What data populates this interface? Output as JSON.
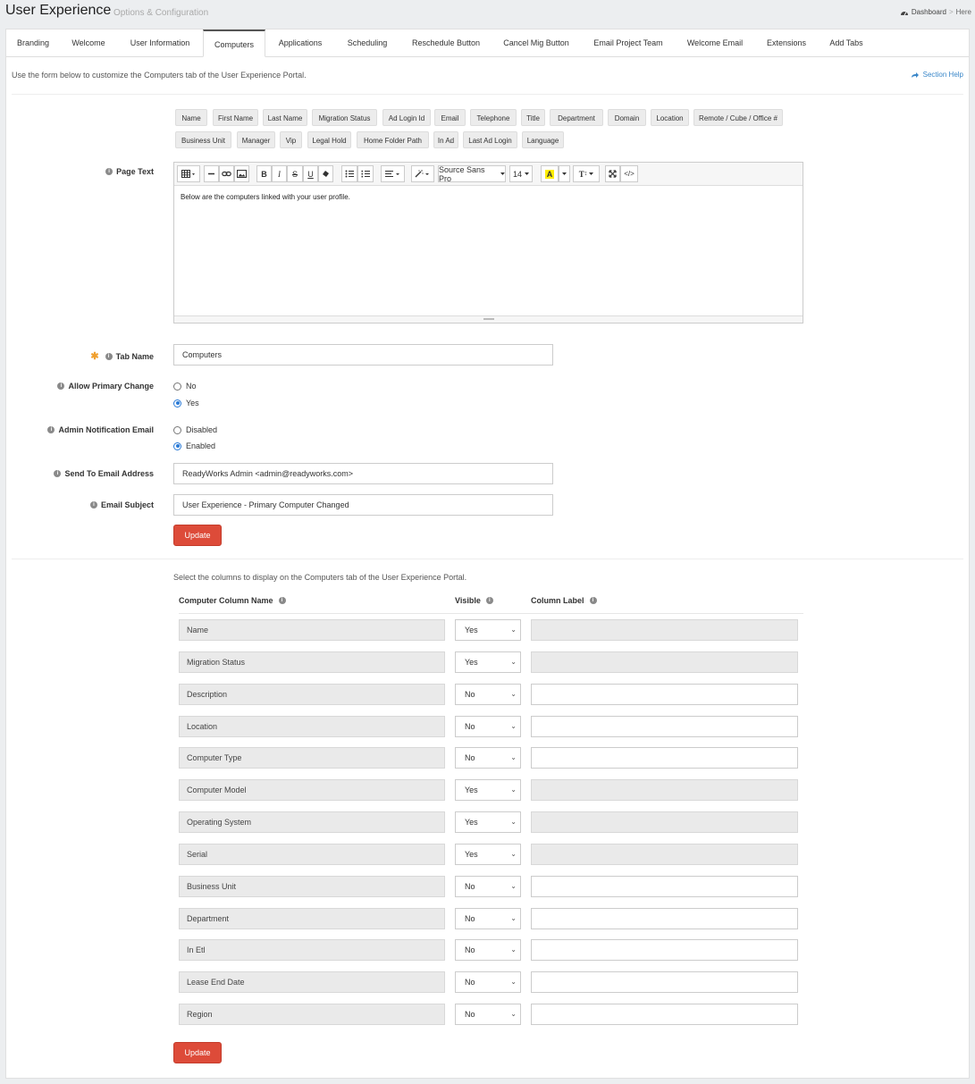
{
  "header": {
    "title": "User Experience",
    "subtitle": "Options & Configuration",
    "breadcrumb": [
      "Dashboard",
      "Here"
    ]
  },
  "tabs": [
    "Branding",
    "Welcome",
    "User Information",
    "Computers",
    "Applications",
    "Scheduling",
    "Reschedule Button",
    "Cancel Mig Button",
    "Email Project Team",
    "Welcome Email",
    "Extensions",
    "Add Tabs"
  ],
  "active_tab": "Computers",
  "intro": "Use the form below to customize the Computers tab of the User Experience Portal.",
  "section_help": "Section Help",
  "tokens": [
    "Name",
    "First Name",
    "Last Name",
    "Migration Status",
    "Ad Login Id",
    "Email",
    "Telephone",
    "Title",
    "Department",
    "Domain",
    "Location",
    "Remote / Cube / Office #",
    "Business Unit",
    "Manager",
    "Vip",
    "Legal Hold",
    "Home Folder Path",
    "In Ad",
    "Last Ad Login",
    "Language"
  ],
  "labels": {
    "page_text": "Page Text",
    "tab_name": "Tab Name",
    "allow_primary_change": "Allow Primary Change",
    "admin_notification_email": "Admin Notification Email",
    "send_to_email": "Send To Email Address",
    "email_subject": "Email Subject"
  },
  "editor": {
    "font": "Source Sans Pro",
    "size": "14",
    "content": "Below are the computers linked with your user profile."
  },
  "form": {
    "tab_name": "Computers",
    "allow_primary_change": {
      "options": [
        "No",
        "Yes"
      ],
      "selected": "Yes"
    },
    "admin_notification": {
      "options": [
        "Disabled",
        "Enabled"
      ],
      "selected": "Enabled"
    },
    "send_to_email": "ReadyWorks Admin <admin@readyworks.com>",
    "email_subject": "User Experience - Primary Computer Changed"
  },
  "update_label": "Update",
  "columns_note": "Select the columns to display on the Computers tab of the User Experience Portal.",
  "table_headers": {
    "name": "Computer Column Name",
    "visible": "Visible",
    "label": "Column Label"
  },
  "columns": [
    {
      "name": "Name",
      "visible": "Yes",
      "label": ""
    },
    {
      "name": "Migration Status",
      "visible": "Yes",
      "label": ""
    },
    {
      "name": "Description",
      "visible": "No",
      "label": ""
    },
    {
      "name": "Location",
      "visible": "No",
      "label": ""
    },
    {
      "name": "Computer Type",
      "visible": "No",
      "label": ""
    },
    {
      "name": "Computer Model",
      "visible": "Yes",
      "label": ""
    },
    {
      "name": "Operating System",
      "visible": "Yes",
      "label": ""
    },
    {
      "name": "Serial",
      "visible": "Yes",
      "label": ""
    },
    {
      "name": "Business Unit",
      "visible": "No",
      "label": ""
    },
    {
      "name": "Department",
      "visible": "No",
      "label": ""
    },
    {
      "name": "In Etl",
      "visible": "No",
      "label": ""
    },
    {
      "name": "Lease End Date",
      "visible": "No",
      "label": ""
    },
    {
      "name": "Region",
      "visible": "No",
      "label": ""
    }
  ],
  "colors": {
    "accent": "#dd4b39",
    "link": "#3a87c9",
    "required": "#f0a030"
  }
}
